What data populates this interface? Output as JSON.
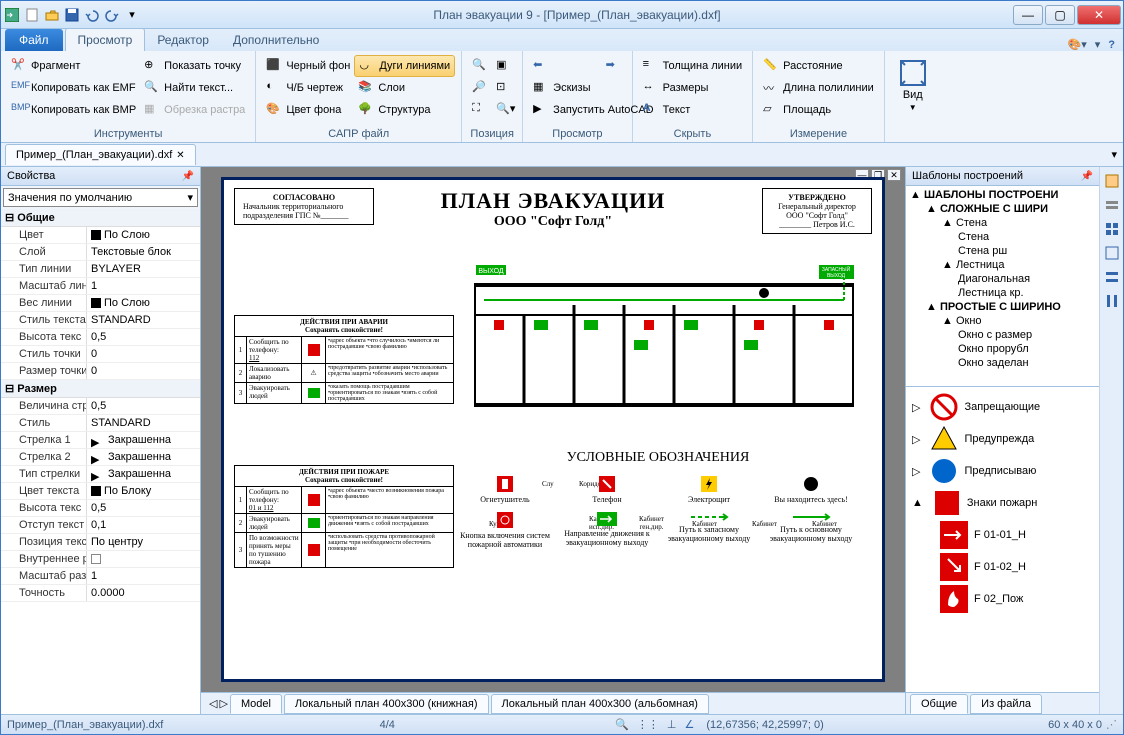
{
  "window": {
    "title": "План эвакуации 9 - [Пример_(План_эвакуации).dxf]"
  },
  "tabs": {
    "file": "Файл",
    "view": "Просмотр",
    "editor": "Редактор",
    "extra": "Дополнительно"
  },
  "ribbon": {
    "groups": {
      "tools": "Инструменты",
      "sapr": "САПР файл",
      "position": "Позиция",
      "view": "Просмотр",
      "hide": "Скрыть",
      "measure": "Измерение",
      "viewbtn": "Вид"
    },
    "btns": {
      "fragment": "Фрагмент",
      "copy_emf": "Копировать как EMF",
      "copy_bmp": "Копировать как BMP",
      "show_point": "Показать точку",
      "find_text": "Найти текст...",
      "trim_raster": "Обрезка растра",
      "black_bg": "Черный фон",
      "bw_draw": "Ч/Б чертеж",
      "bg_color": "Цвет фона",
      "arcs_lines": "Дуги линиями",
      "layers": "Слои",
      "structure": "Структура",
      "sketches": "Эскизы",
      "run_autocad": "Запустить AutoCAD",
      "line_thick": "Толщина линии",
      "dimensions": "Размеры",
      "text": "Текст",
      "distance": "Расстояние",
      "polylen": "Длина полилинии",
      "area": "Площадь"
    }
  },
  "doctab": "Пример_(План_эвакуации).dxf",
  "props": {
    "title": "Свойства",
    "defaults": "Значения по умолчанию",
    "cat_common": "Общие",
    "cat_size": "Размер",
    "rows": [
      {
        "k": "Цвет",
        "v": "По Слою"
      },
      {
        "k": "Слой",
        "v": "Текстовые блок"
      },
      {
        "k": "Тип линии",
        "v": "BYLAYER"
      },
      {
        "k": "Масштаб лини",
        "v": "1"
      },
      {
        "k": "Вес линии",
        "v": "По Слою"
      },
      {
        "k": "Стиль текста",
        "v": "STANDARD"
      },
      {
        "k": "Высота текс",
        "v": "0,5"
      },
      {
        "k": "Стиль точки",
        "v": "0"
      },
      {
        "k": "Размер точки",
        "v": "0"
      }
    ],
    "rows2": [
      {
        "k": "Величина стр",
        "v": "0,5"
      },
      {
        "k": "Стиль",
        "v": "STANDARD"
      },
      {
        "k": "Стрелка 1",
        "v": "Закрашенна"
      },
      {
        "k": "Стрелка 2",
        "v": "Закрашенна"
      },
      {
        "k": "Тип стрелки",
        "v": "Закрашенна"
      },
      {
        "k": "Цвет текста",
        "v": "По Блоку"
      },
      {
        "k": "Высота текс",
        "v": "0,5"
      },
      {
        "k": "Отступ текст",
        "v": "0,1"
      },
      {
        "k": "Позиция текс",
        "v": "По центру"
      },
      {
        "k": "Внутреннее р",
        "v": ""
      },
      {
        "k": "Масштаб раз",
        "v": "1"
      },
      {
        "k": "Точность",
        "v": "0.0000"
      }
    ]
  },
  "plan": {
    "title": "ПЛАН ЭВАКУАЦИИ",
    "subtitle": "ООО \"Софт Голд\"",
    "approve_left_title": "СОГЛАСОВАНО",
    "approve_left_text": "Начальник территориального подразделения ГПС №_______",
    "approve_right_title": "УТВЕРЖДЕНО",
    "approve_right_text1": "Генеральный директор",
    "approve_right_text2": "ООО \"Софт Голд\"",
    "approve_right_text3": "________ Петров И.С.",
    "exit_main": "ВЫХОД",
    "exit_emerg": "ЗАПАСНЫЙ ВЫХОД",
    "rooms": {
      "kitchen": "Кухня",
      "clu": "Слу",
      "corridor": "Коридор",
      "cab_isp": "Кабинет исп.дир.",
      "cab_gen": "Кабинет ген.дир.",
      "cab1": "Кабинет",
      "cab2": "Кабинет",
      "cab3": "Кабинет"
    },
    "actions_emergency": {
      "title": "ДЕЙСТВИЯ ПРИ АВАРИИ",
      "subtitle": "Сохранять спокойствие!",
      "r1_label": "Сообщить по телефону:",
      "r1_phone": "112",
      "r1_desc": "•адрес объекта\n•что случилось\n•имеются ли пострадавшие\n•свою фамилию",
      "r2_label": "Локализовать аварию",
      "r2_desc": "•предотвратить развитие аварии\n•использовать средства защиты\n•обозначить место аварии",
      "r3_label": "Эвакуировать людей",
      "r3_desc": "•оказать помощь пострадавшим\n•ориентироваться по знакам\n•взять с собой пострадавших"
    },
    "actions_fire": {
      "title": "ДЕЙСТВИЯ ПРИ ПОЖАРЕ",
      "subtitle": "Сохранять спокойствие!",
      "r1_label": "Сообщить по телефону:",
      "r1_phone": "01 и 112",
      "r1_desc": "•адрес объекта\n•место возникновения пожара\n•свою фамилию",
      "r2_label": "Эвакуировать людей",
      "r2_desc": "•ориентироваться по знакам направления движения\n•взять с собой пострадавших",
      "r3_label": "По возможности принять меры по тушению пожара",
      "r3_desc": "•использовать средства противопожарной защиты\n•при необходимости обесточить помещение"
    },
    "legend_title": "УСЛОВНЫЕ ОБОЗНАЧЕНИЯ",
    "legend": {
      "extinguisher": "Огнетушитель",
      "phone": "Телефон",
      "electric": "Электрощит",
      "youhere": "Вы находитесь здесь!",
      "alarm": "Кнопка включения систем пожарной автоматики",
      "direction": "Направление движения к эвакуационному выходу",
      "emerg_route": "Путь к запасному эвакуационному выходу",
      "main_route": "Путь к основному эвакуационному выходу"
    }
  },
  "modeltabs": {
    "model": "Model",
    "layout1": "Локальный план 400x300 (книжная)",
    "layout2": "Локальный план 400x300 (альбомная)"
  },
  "right": {
    "title": "Шаблоны построений",
    "root": "ШАБЛОНЫ ПОСТРОЕНИ",
    "cat1": "СЛОЖНЫЕ С ШИРИ",
    "wall": "Стена",
    "wallsub1": "Стена",
    "wallsub2": "Стена рш",
    "stair": "Лестница",
    "stairsub1": "Диагональная",
    "stairsub2": "Лестница кр.",
    "cat2": "ПРОСТЫЕ С ШИРИНО",
    "window": "Окно",
    "winsub1": "Окно с размер",
    "winsub2": "Окно прорубл",
    "winsub3": "Окно заделан",
    "signs": {
      "prohibit": "Запрещающие",
      "warning": "Предупрежда",
      "prescribe": "Предписываю",
      "fire": "Знаки пожарн",
      "f0101": "F 01-01_Н",
      "f0102": "F 01-02_Н",
      "f02": "F 02_Пож"
    },
    "tabs": {
      "common": "Общие",
      "fromfile": "Из файла"
    }
  },
  "status": {
    "file": "Пример_(План_эвакуации).dxf",
    "pages": "4/4",
    "coords": "(12,67356; 42,25997; 0)",
    "dims": "60 x 40 x 0"
  }
}
